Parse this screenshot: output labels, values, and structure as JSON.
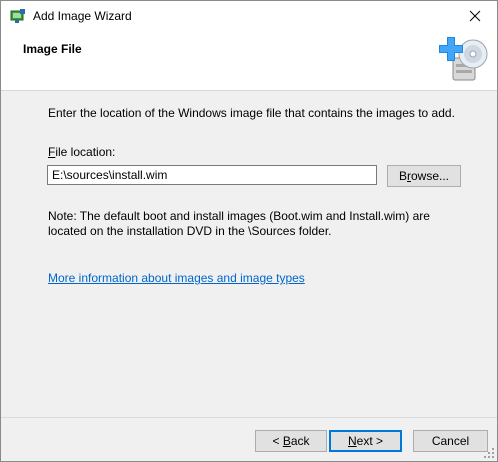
{
  "window": {
    "title": "Add Image Wizard",
    "close_symbol": "✕"
  },
  "header": {
    "title": "Image File",
    "icon": "add-image-disc-icon"
  },
  "content": {
    "instruction": "Enter the location of the Windows image file that contains the images to add.",
    "file_location_label_accel": "F",
    "file_location_label_rest": "ile location:",
    "file_location_value": "E:\\sources\\install.wim",
    "browse_accel": "r",
    "browse_pre": "B",
    "browse_post": "owse...",
    "note": "Note: The default boot and install images (Boot.wim and Install.wim) are located on the installation DVD in the \\Sources folder.",
    "info_link": "More information about images and image types"
  },
  "footer": {
    "back_pre": "< ",
    "back_accel": "B",
    "back_post": "ack",
    "next_accel": "N",
    "next_post": "ext >",
    "cancel": "Cancel"
  },
  "colors": {
    "link": "#0066cc",
    "default_button_border": "#0078d7",
    "dialog_bg": "#f0f0f0"
  }
}
